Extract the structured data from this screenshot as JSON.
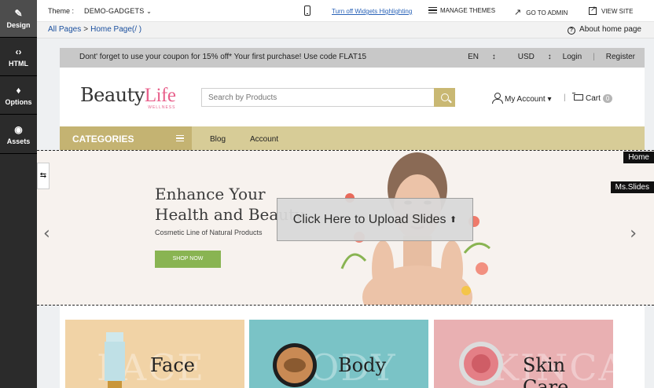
{
  "sidebar": {
    "items": [
      {
        "label": "Design",
        "icon": "brush-icon"
      },
      {
        "label": "HTML",
        "icon": "code-icon"
      },
      {
        "label": "Options",
        "icon": "droplets-icon"
      },
      {
        "label": "Assets",
        "icon": "palette-icon"
      }
    ]
  },
  "topbar": {
    "theme_label": "Theme :",
    "theme_value": "DEMO-GADGETS",
    "widgets_link": "Turn off Widgets Highlighting",
    "manage_themes": "MANAGE THEMES",
    "go_admin": "GO TO ADMIN",
    "view_site": "VIEW SITE"
  },
  "breadcrumb": {
    "all_pages": "All Pages",
    "separator": ">",
    "current": "Home Page(/ )",
    "about": "About home page"
  },
  "promo": {
    "message": "Dont' forget to use your coupon for 15% off* Your first purchase! Use code FLAT15",
    "language": "EN",
    "currency": "USD",
    "login": "Login",
    "divider": "|",
    "register": "Register"
  },
  "header": {
    "logo_beauty": "Beauty",
    "logo_life": "Life",
    "logo_wellness": "WELLNESS",
    "search_placeholder": "Search by Products",
    "my_account": "My Account",
    "cart_label": "Cart",
    "cart_count": "0"
  },
  "nav": {
    "categories": "CATEGORIES",
    "links": [
      "Blog",
      "Account"
    ]
  },
  "hero": {
    "title": "Enhance Your\nHealth and Beauty",
    "subtitle": "Cosmetic Line of Natural Products",
    "button": "SHOP NOW",
    "upload": "Click Here to Upload Slides",
    "tag_home": "Home",
    "tag_slides": "Ms.Slides"
  },
  "tiles": [
    {
      "label": "Face",
      "ghost": "FACE",
      "bg": "#f1d3a6"
    },
    {
      "label": "Body",
      "ghost": "BODY",
      "bg": "#7ac3c6"
    },
    {
      "label": "Skin Care",
      "ghost": "SKINCARE",
      "bg": "#e9b0b2"
    }
  ],
  "colors": {
    "sidebar": "#2b2b2b",
    "accent_gold": "#c4b372",
    "nav_gold": "#d7cc97",
    "shop_green": "#89b452",
    "logo_pink": "#e8618c"
  }
}
